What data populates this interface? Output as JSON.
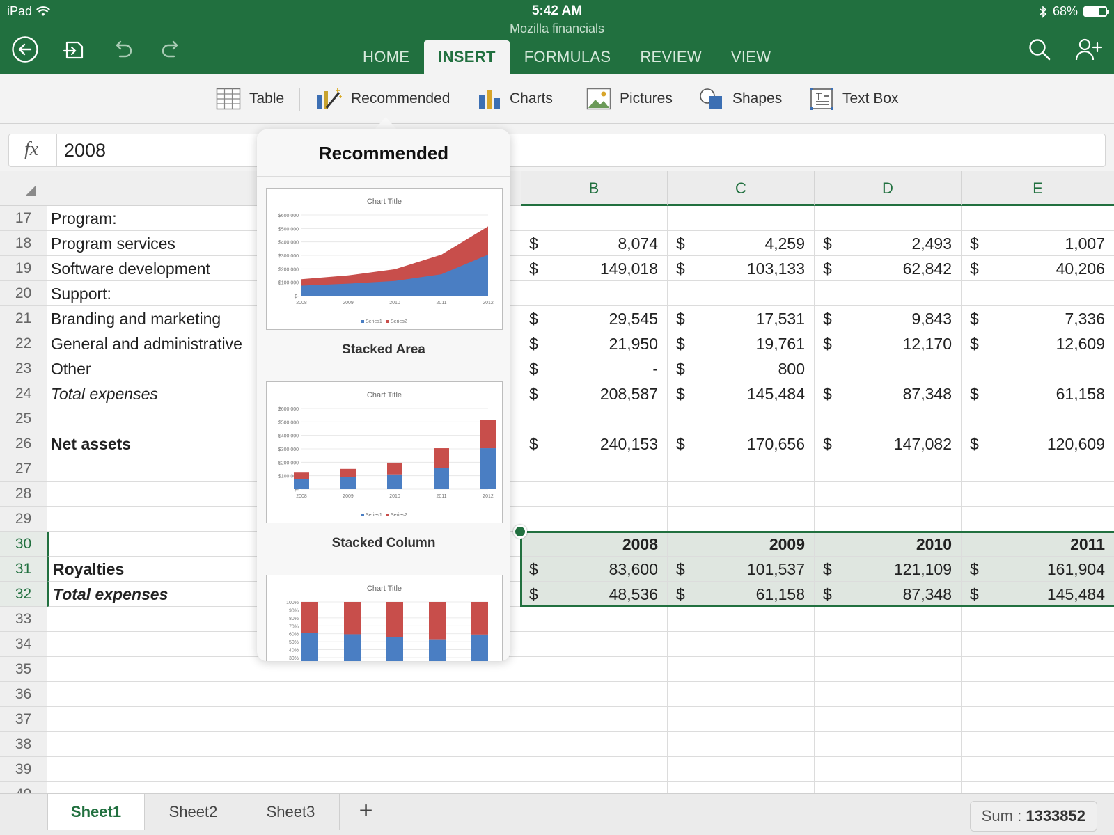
{
  "status": {
    "device": "iPad",
    "time": "5:42 AM",
    "battery": "68%"
  },
  "document": {
    "title": "Mozilla financials"
  },
  "ribbon": {
    "tabs": [
      "HOME",
      "INSERT",
      "FORMULAS",
      "REVIEW",
      "VIEW"
    ],
    "active": "INSERT"
  },
  "toolbar": {
    "table": "Table",
    "recommended": "Recommended",
    "charts": "Charts",
    "pictures": "Pictures",
    "shapes": "Shapes",
    "textbox": "Text Box"
  },
  "formula": {
    "label": "fx",
    "value": "2008"
  },
  "columns": [
    "B",
    "C",
    "D",
    "E"
  ],
  "rows": [
    {
      "num": "17",
      "label": "Program:",
      "cells": []
    },
    {
      "num": "18",
      "label": "Program services",
      "cells": [
        "8,074",
        "4,259",
        "2,493",
        "1,007"
      ]
    },
    {
      "num": "19",
      "label": "Software development",
      "cells": [
        "149,018",
        "103,133",
        "62,842",
        "40,206"
      ]
    },
    {
      "num": "20",
      "label": "Support:",
      "cells": []
    },
    {
      "num": "21",
      "label": "Branding and marketing",
      "cells": [
        "29,545",
        "17,531",
        "9,843",
        "7,336"
      ]
    },
    {
      "num": "22",
      "label": "General and administrative",
      "cells": [
        "21,950",
        "19,761",
        "12,170",
        "12,609"
      ]
    },
    {
      "num": "23",
      "label": "Other",
      "cells": [
        "-",
        "800"
      ]
    },
    {
      "num": "24",
      "label": "Total expenses",
      "style": "italic",
      "cells": [
        "208,587",
        "145,484",
        "87,348",
        "61,158"
      ]
    },
    {
      "num": "25",
      "label": "",
      "cells": []
    },
    {
      "num": "26",
      "label": "Net assets",
      "style": "bold",
      "cells": [
        "240,153",
        "170,656",
        "147,082",
        "120,609"
      ]
    },
    {
      "num": "27",
      "label": "",
      "cells": []
    },
    {
      "num": "28",
      "label": "",
      "cells": []
    },
    {
      "num": "29",
      "label": "",
      "cells": []
    },
    {
      "num": "30",
      "label": "",
      "selected": true,
      "years": [
        "2008",
        "2009",
        "2010",
        "2011"
      ],
      "cells": []
    },
    {
      "num": "31",
      "label": "Royalties",
      "style": "bold",
      "selected": true,
      "cells": [
        "83,600",
        "101,537",
        "121,109",
        "161,904"
      ]
    },
    {
      "num": "32",
      "label": "Total expenses",
      "style": "bold italic",
      "selected": true,
      "cells": [
        "48,536",
        "61,158",
        "87,348",
        "145,484"
      ]
    },
    {
      "num": "33",
      "label": "",
      "cells": []
    },
    {
      "num": "34",
      "label": "",
      "cells": []
    },
    {
      "num": "35",
      "label": "",
      "cells": []
    },
    {
      "num": "36",
      "label": "",
      "cells": []
    },
    {
      "num": "37",
      "label": "",
      "cells": []
    },
    {
      "num": "38",
      "label": "",
      "cells": []
    },
    {
      "num": "39",
      "label": "",
      "cells": []
    },
    {
      "num": "40",
      "label": "",
      "cells": []
    }
  ],
  "currency": "$",
  "popover": {
    "title": "Recommended",
    "options": [
      {
        "label": "Stacked Area",
        "chart_title": "Chart Title"
      },
      {
        "label": "Stacked Column",
        "chart_title": "Chart Title"
      },
      {
        "label": "",
        "chart_title": "Chart Title"
      }
    ],
    "preview": {
      "years": [
        "2008",
        "2009",
        "2010",
        "2011",
        "2012"
      ],
      "y_ticks": [
        "$600,000",
        "$500,000",
        "$400,000",
        "$300,000",
        "$200,000",
        "$100,000",
        "$-"
      ],
      "pct_ticks": [
        "100%",
        "90%",
        "80%",
        "70%",
        "60%",
        "50%",
        "40%",
        "30%"
      ],
      "legend": [
        "Series1",
        "Series2"
      ],
      "series1": [
        75000,
        90000,
        110000,
        160000,
        305000
      ],
      "series2": [
        48000,
        61000,
        87000,
        145000,
        210000
      ],
      "colors": {
        "series1": "#4a7ec3",
        "series2": "#c84e4b"
      }
    }
  },
  "sheets": [
    "Sheet1",
    "Sheet2",
    "Sheet3"
  ],
  "active_sheet": "Sheet1",
  "status_bar": {
    "sum_label": "Sum :",
    "sum_value": "1333852"
  },
  "colors": {
    "accent": "#21703f"
  }
}
